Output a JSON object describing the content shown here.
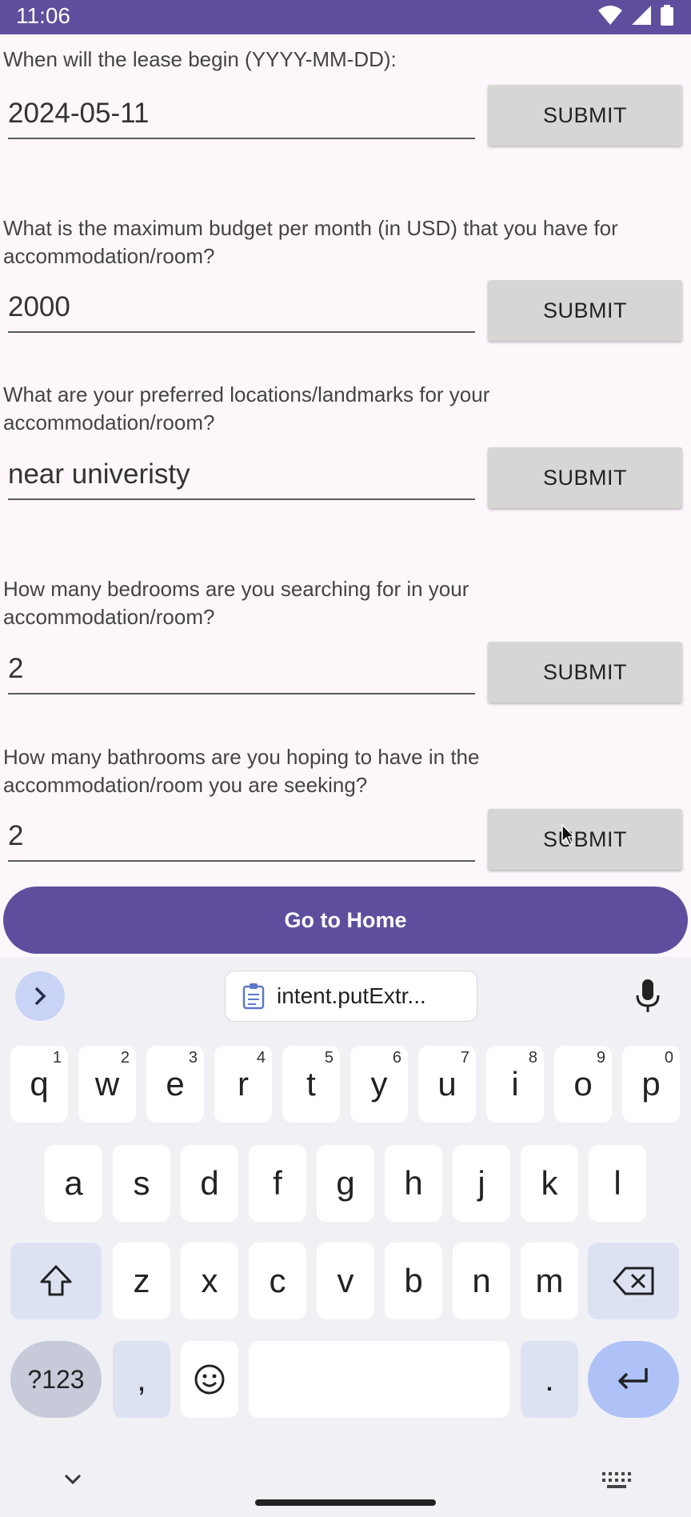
{
  "status_bar": {
    "time": "11:06"
  },
  "questions": [
    {
      "label": "When will the lease begin (YYYY-MM-DD):",
      "value": "2024-05-11",
      "submit": "SUBMIT"
    },
    {
      "label": "What is the maximum budget per month (in USD) that you have for accommodation/room?",
      "value": "2000",
      "submit": "SUBMIT"
    },
    {
      "label": "What are your preferred locations/landmarks for your accommodation/room?",
      "value": "near univeristy",
      "submit": "SUBMIT"
    },
    {
      "label": "How many bedrooms are you searching for in your accommodation/room?",
      "value": "2",
      "submit": "SUBMIT"
    },
    {
      "label": "How many bathrooms are you hoping to have in the accommodation/room you are seeking?",
      "value": "2",
      "submit": "SUBMIT"
    }
  ],
  "home_button": "Go to Home",
  "keyboard": {
    "clipboard_chip": "intent.putExtr...",
    "row1": [
      {
        "k": "q",
        "h": "1"
      },
      {
        "k": "w",
        "h": "2"
      },
      {
        "k": "e",
        "h": "3"
      },
      {
        "k": "r",
        "h": "4"
      },
      {
        "k": "t",
        "h": "5"
      },
      {
        "k": "y",
        "h": "6"
      },
      {
        "k": "u",
        "h": "7"
      },
      {
        "k": "i",
        "h": "8"
      },
      {
        "k": "o",
        "h": "9"
      },
      {
        "k": "p",
        "h": "0"
      }
    ],
    "row2": [
      "a",
      "s",
      "d",
      "f",
      "g",
      "h",
      "j",
      "k",
      "l"
    ],
    "row3": [
      "z",
      "x",
      "c",
      "v",
      "b",
      "n",
      "m"
    ],
    "symbols_key": "?123",
    "comma_key": ",",
    "period_key": "."
  },
  "colors": {
    "primary": "#5f4e9e",
    "background": "#fdf6fb",
    "submit_bg": "#d6d7d5"
  }
}
